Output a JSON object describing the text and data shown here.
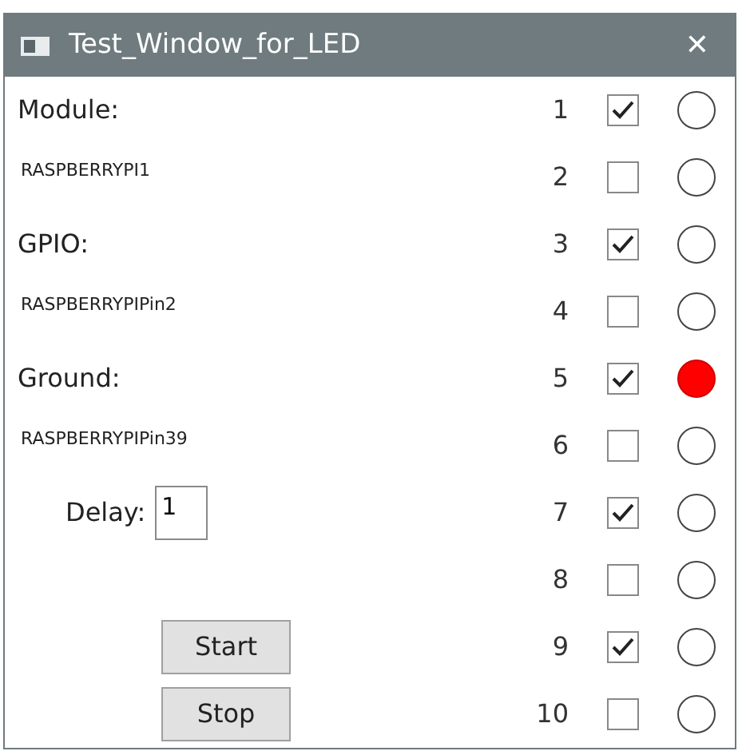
{
  "window": {
    "title": "Test_Window_for_LED",
    "close": "✕"
  },
  "left": [
    {
      "kind": "label",
      "text": "Module:"
    },
    {
      "kind": "value",
      "text": "RASPBERRYPI1"
    },
    {
      "kind": "label",
      "text": "GPIO:"
    },
    {
      "kind": "value",
      "text": "RASPBERRYPIPin2"
    },
    {
      "kind": "label",
      "text": "Ground:"
    },
    {
      "kind": "value",
      "text": "RASPBERRYPIPin39"
    },
    {
      "kind": "field",
      "label": "Delay:",
      "value": "1"
    },
    {
      "kind": "blank"
    },
    {
      "kind": "button",
      "text": "Start"
    },
    {
      "kind": "button",
      "text": "Stop"
    }
  ],
  "leds": [
    {
      "number": "1",
      "checked": true,
      "lit": false
    },
    {
      "number": "2",
      "checked": false,
      "lit": false
    },
    {
      "number": "3",
      "checked": true,
      "lit": false
    },
    {
      "number": "4",
      "checked": false,
      "lit": false
    },
    {
      "number": "5",
      "checked": true,
      "lit": true
    },
    {
      "number": "6",
      "checked": false,
      "lit": false
    },
    {
      "number": "7",
      "checked": true,
      "lit": false
    },
    {
      "number": "8",
      "checked": false,
      "lit": false
    },
    {
      "number": "9",
      "checked": true,
      "lit": false
    },
    {
      "number": "10",
      "checked": false,
      "lit": false
    }
  ]
}
